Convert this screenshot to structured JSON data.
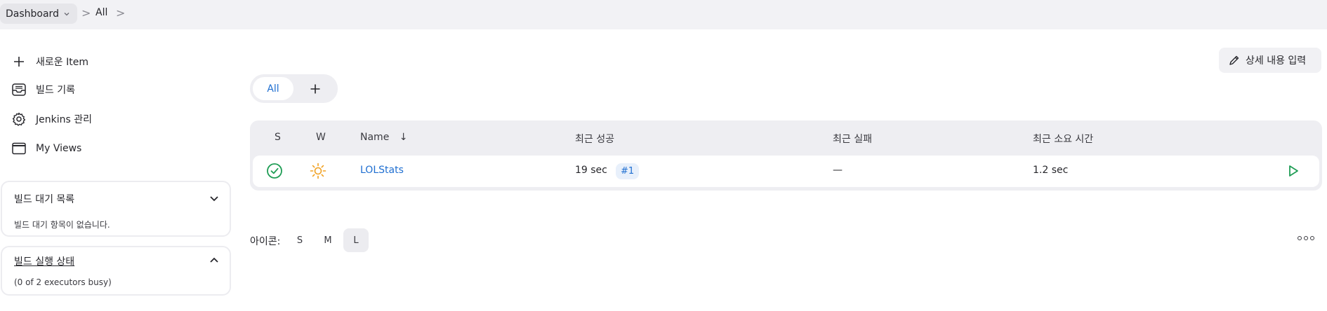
{
  "breadcrumb": {
    "dashboard": "Dashboard",
    "all": "All",
    "separator": ">"
  },
  "sidebar": {
    "items": [
      {
        "label": "새로운 Item",
        "icon": "plus-icon"
      },
      {
        "label": "빌드 기록",
        "icon": "inbox-icon"
      },
      {
        "label": "Jenkins 관리",
        "icon": "gear-icon"
      },
      {
        "label": "My Views",
        "icon": "window-icon"
      }
    ],
    "build_queue": {
      "title": "빌드 대기 목록",
      "empty_text": "빌드 대기 항목이 없습니다."
    },
    "executor_status": {
      "title": "빌드 실행 상태",
      "text": "(0 of 2 executors busy)"
    }
  },
  "views": {
    "tabs": [
      {
        "label": "All"
      }
    ],
    "add_icon": "plus-icon"
  },
  "edit_description": {
    "label": "상세 내용 입력",
    "icon": "pencil-icon"
  },
  "table": {
    "headers": {
      "s": "S",
      "w": "W",
      "name": "Name",
      "sort_indicator": "↓",
      "last_success": "최근 성공",
      "last_failure": "최근 실패",
      "last_duration": "최근 소요 시간"
    },
    "rows": [
      {
        "status_icon": "success-check-icon",
        "weather_icon": "sunny-icon",
        "name": "LOLStats",
        "last_success": "19 sec",
        "build_number": "#1",
        "last_failure": "—",
        "last_duration": "1.2 sec",
        "action_icon": "play-icon"
      }
    ]
  },
  "icon_size": {
    "label": "아이콘:",
    "options": [
      "S",
      "M",
      "L"
    ],
    "selected": "L"
  },
  "colors": {
    "accent": "#1f6fd1",
    "success": "#1f9d55",
    "sun": "#f0a020"
  }
}
